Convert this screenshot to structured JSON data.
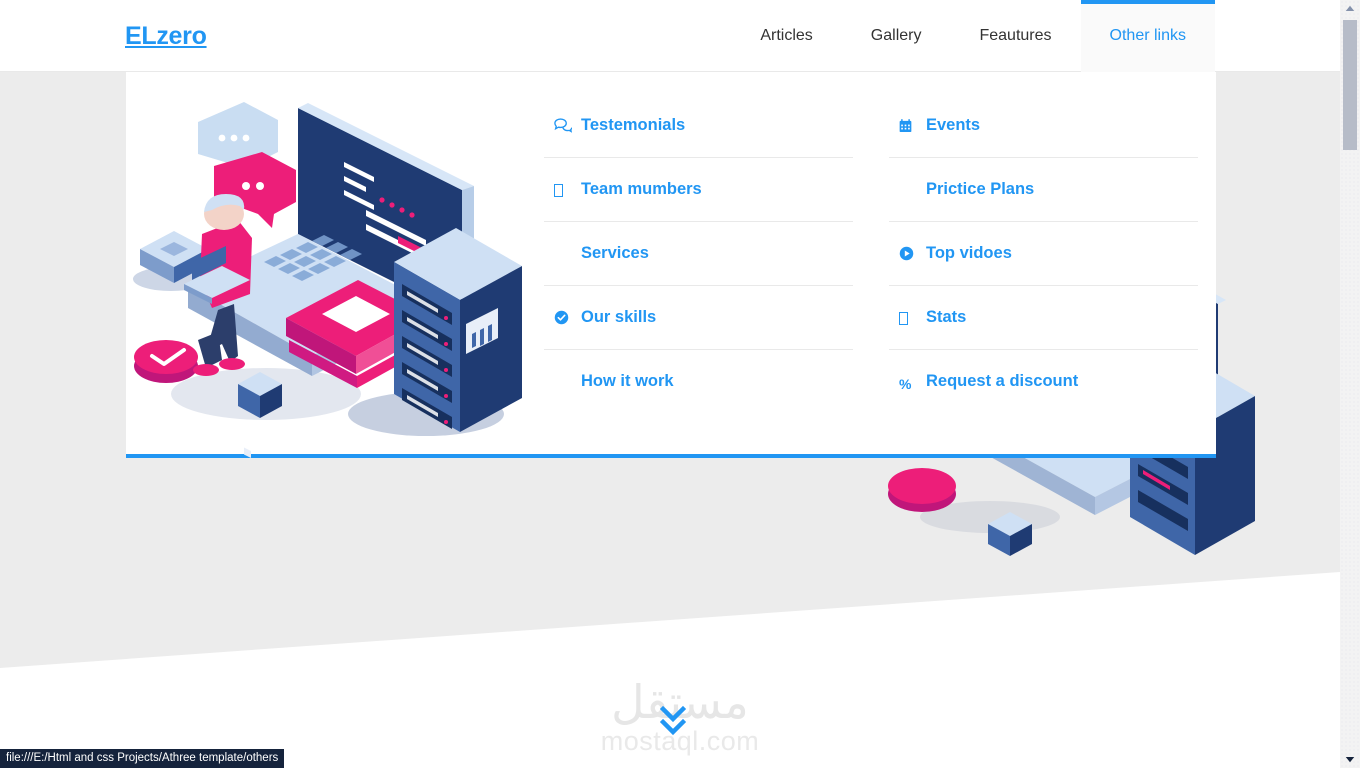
{
  "browser": {
    "status_url": "file:///E:/Html and css Projects/Athree template/others"
  },
  "header": {
    "logo": "ELzero",
    "nav": [
      {
        "label": "Articles",
        "active": false
      },
      {
        "label": "Gallery",
        "active": false
      },
      {
        "label": "Feautures",
        "active": false
      },
      {
        "label": "Other links",
        "active": true
      }
    ]
  },
  "mega_menu": {
    "image_alt": "isometric-developer-illustration",
    "columns": [
      {
        "items": [
          {
            "label": "Testemonials",
            "icon": "comments-icon"
          },
          {
            "label": "Team mumbers",
            "icon": "missing-glyph-icon"
          },
          {
            "label": "Services",
            "icon": "none"
          },
          {
            "label": "Our skills",
            "icon": "check-circle-icon"
          },
          {
            "label": "How it work",
            "icon": "none"
          }
        ]
      },
      {
        "items": [
          {
            "label": "Events",
            "icon": "calendar-icon"
          },
          {
            "label": "Prictice Plans",
            "icon": "none"
          },
          {
            "label": "Top vidoes",
            "icon": "play-circle-icon"
          },
          {
            "label": "Stats",
            "icon": "missing-glyph-icon"
          },
          {
            "label": "Request a discount",
            "icon": "percent-icon"
          }
        ]
      }
    ]
  },
  "hero": {
    "scroll_hint_icon": "double-chevron-down-icon"
  },
  "watermark": {
    "arabic": "مستقل",
    "latin": "mostaql.com"
  },
  "colors": {
    "brand_blue": "#2196f3",
    "accent_pink": "#ed1e79",
    "dark_navy": "#1f3b73",
    "page_gray": "#ececec",
    "status_bar_bg": "#15233c"
  }
}
